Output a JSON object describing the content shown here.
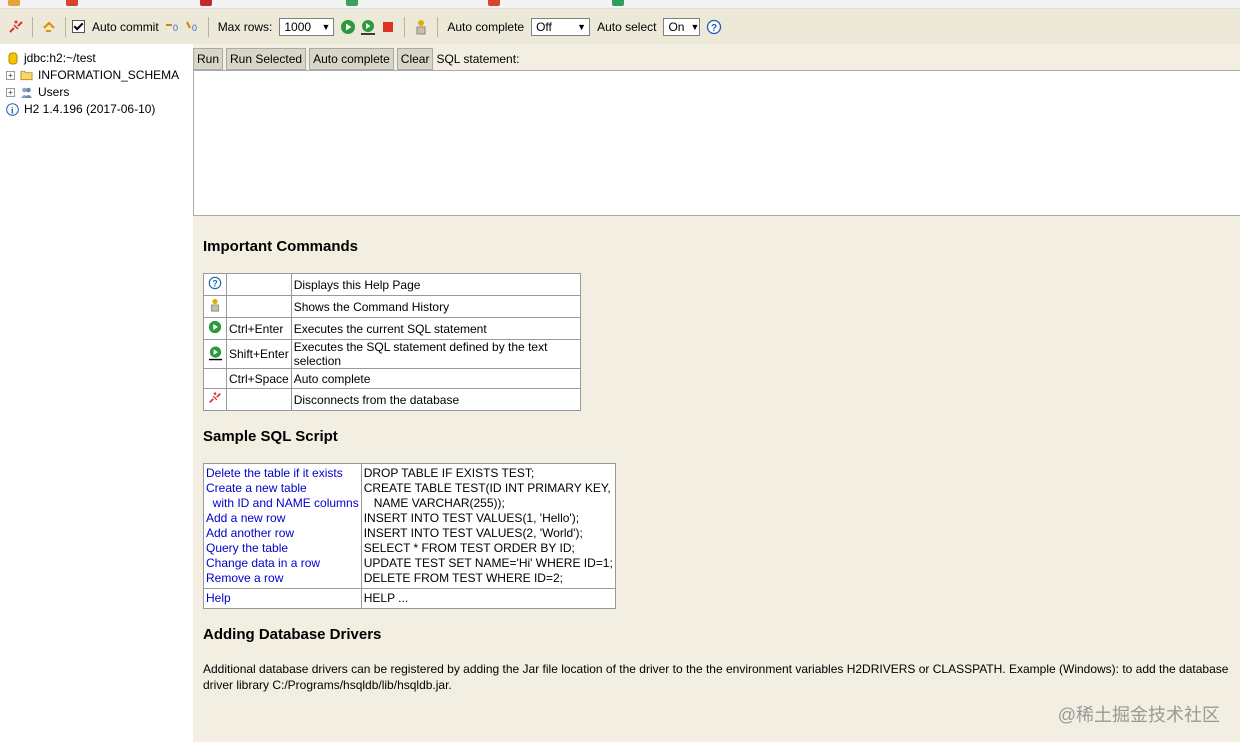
{
  "toolbar": {
    "auto_commit_label": "Auto commit",
    "max_rows_label": "Max rows:",
    "max_rows_value": "1000",
    "auto_complete_label": "Auto complete",
    "auto_complete_value": "Off",
    "auto_select_label": "Auto select",
    "auto_select_value": "On"
  },
  "tree": {
    "connection": "jdbc:h2:~/test",
    "schema": "INFORMATION_SCHEMA",
    "users": "Users",
    "version": "H2 1.4.196 (2017-06-10)"
  },
  "query": {
    "run": "Run",
    "run_selected": "Run Selected",
    "auto_complete": "Auto complete",
    "clear": "Clear",
    "label": "SQL statement:"
  },
  "help": {
    "important_title": "Important Commands",
    "commands": [
      {
        "icon": "help-icon",
        "key": "",
        "desc": "Displays this Help Page"
      },
      {
        "icon": "history-icon",
        "key": "",
        "desc": "Shows the Command History"
      },
      {
        "icon": "run-icon",
        "key": "Ctrl+Enter",
        "desc": "Executes the current SQL statement"
      },
      {
        "icon": "run-selected-icon",
        "key": "Shift+Enter",
        "desc": "Executes the SQL statement defined by the text selection"
      },
      {
        "icon": "",
        "key": "Ctrl+Space",
        "desc": "Auto complete"
      },
      {
        "icon": "disconnect-icon",
        "key": "",
        "desc": "Disconnects from the database"
      }
    ],
    "sample_title": "Sample SQL Script",
    "sample": [
      {
        "label": "Delete the table if it exists",
        "sql": "DROP TABLE IF EXISTS TEST;"
      },
      {
        "label": "Create a new table",
        "sql": "CREATE TABLE TEST(ID INT PRIMARY KEY,"
      },
      {
        "label": "  with ID and NAME columns",
        "sql": "   NAME VARCHAR(255));"
      },
      {
        "label": "Add a new row",
        "sql": "INSERT INTO TEST VALUES(1, 'Hello');"
      },
      {
        "label": "Add another row",
        "sql": "INSERT INTO TEST VALUES(2, 'World');"
      },
      {
        "label": "Query the table",
        "sql": "SELECT * FROM TEST ORDER BY ID;"
      },
      {
        "label": "Change data in a row",
        "sql": "UPDATE TEST SET NAME='Hi' WHERE ID=1;"
      },
      {
        "label": "Remove a row",
        "sql": "DELETE FROM TEST WHERE ID=2;"
      }
    ],
    "help_row": {
      "label": "Help",
      "sql": "HELP ..."
    },
    "drivers_title": "Adding Database Drivers",
    "drivers_text": "Additional database drivers can be registered by adding the Jar file location of the driver to the the environment variables H2DRIVERS or CLASSPATH. Example (Windows): to add the database driver library C:/Programs/hsqldb/lib/hsqldb.jar."
  },
  "watermark": "@稀土掘金技术社区"
}
